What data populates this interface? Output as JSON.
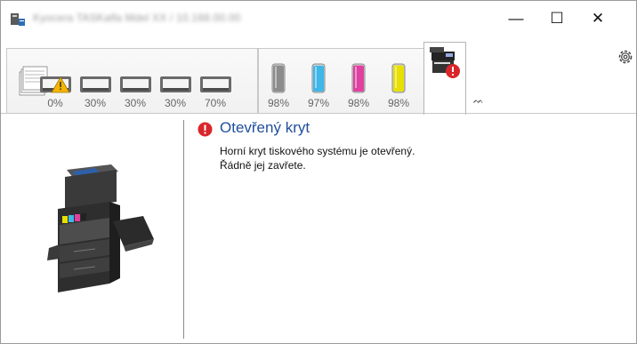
{
  "window": {
    "title": "Kyocera TASKalfa Mdel XX / 10.168.00.00",
    "controls": {
      "minimize": "—",
      "maximize": "☐",
      "close": "✕"
    }
  },
  "toolbar": {
    "trays": [
      {
        "label": "0%",
        "icon": "tray-warning-icon",
        "level": 0
      },
      {
        "label": "30%",
        "icon": "tray-icon",
        "level": 0.3
      },
      {
        "label": "30%",
        "icon": "tray-icon",
        "level": 0.3
      },
      {
        "label": "30%",
        "icon": "tray-icon",
        "level": 0.3
      },
      {
        "label": "70%",
        "icon": "tray-icon",
        "level": 0.7
      }
    ],
    "toners": [
      {
        "label": "98%",
        "color": "#8c8c8c",
        "name": "black",
        "level": 0.98
      },
      {
        "label": "97%",
        "color": "#3fb7e8",
        "name": "cyan",
        "level": 0.97
      },
      {
        "label": "98%",
        "color": "#e040a0",
        "name": "magenta",
        "level": 0.98
      },
      {
        "label": "98%",
        "color": "#e8e000",
        "name": "yellow",
        "level": 0.98
      }
    ],
    "collapse": "ᨓ"
  },
  "alert": {
    "title": "Otevřený kryt",
    "lines": [
      "Horní kryt tiskového systému je otevřený.",
      "Řádně jej zavřete."
    ],
    "accent": "#1f4e9c",
    "error_color": "#d9262b"
  }
}
